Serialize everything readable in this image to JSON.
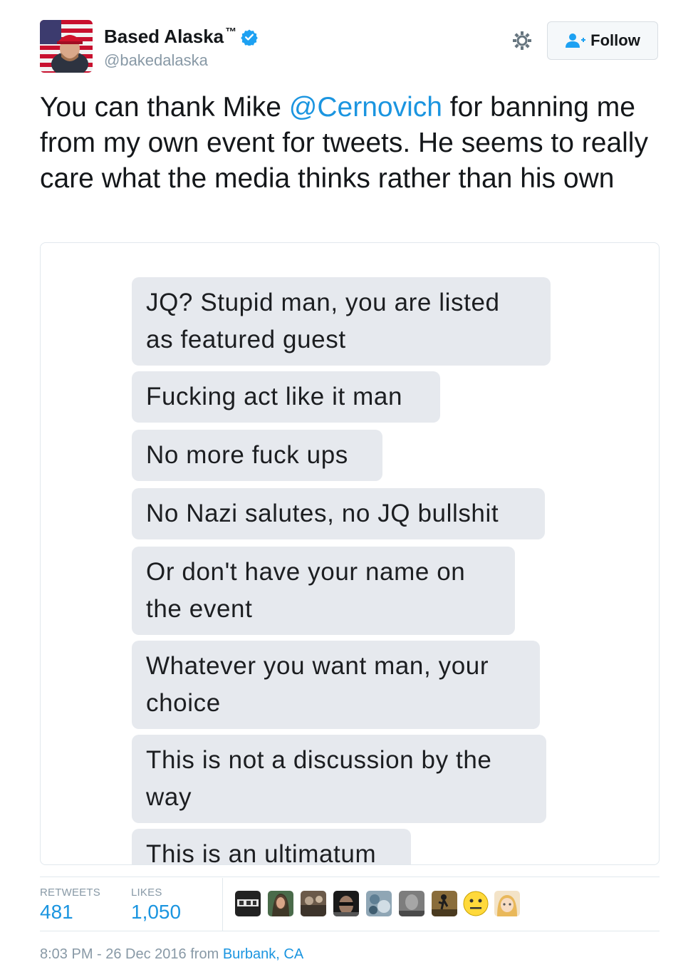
{
  "author": {
    "display_name": "Based Alaska",
    "trademark": "™",
    "handle": "@bakedalaska",
    "verified": true,
    "avatar_icon": "profile-avatar-flag-red-cap"
  },
  "actions": {
    "settings_icon": "gear-icon",
    "follow_label": "Follow",
    "follow_icon": "add-user-icon"
  },
  "tweet": {
    "text_before": "You can thank Mike ",
    "mention": "@Cernovich",
    "text_after": " for banning me from my own event for tweets. He seems to really care what the media thinks rather than his own"
  },
  "screenshot_messages": [
    {
      "line1": "JQ? Stupid man, you are listed",
      "line2": "as featured guest"
    },
    {
      "line1": "Fucking act like it man"
    },
    {
      "line1": "No more fuck ups"
    },
    {
      "line1": "No Nazi salutes, no JQ bullshit"
    },
    {
      "line1": "Or don't have your name on",
      "line2": "the event"
    },
    {
      "line1": "Whatever you want man, your",
      "line2": "choice"
    },
    {
      "line1": "This is not a discussion by the",
      "line2": "way"
    },
    {
      "line1": "This is an ultimatum"
    }
  ],
  "stats": {
    "retweets_label": "RETWEETS",
    "retweets_value": "481",
    "likes_label": "LIKES",
    "likes_value": "1,050"
  },
  "likers": [
    "liker-avatar-1",
    "liker-avatar-2",
    "liker-avatar-3",
    "liker-avatar-4",
    "liker-avatar-5",
    "liker-avatar-6",
    "liker-avatar-7",
    "liker-avatar-8",
    "liker-avatar-9",
    "liker-avatar-10"
  ],
  "meta": {
    "time_date": "8:03 PM - 26 Dec 2016",
    "from_text": " from ",
    "location": "Burbank, CA"
  },
  "colors": {
    "link": "#1b95e0",
    "muted": "#8899a6",
    "bubble": "#e6e9ee",
    "verified": "#1da1f2"
  }
}
